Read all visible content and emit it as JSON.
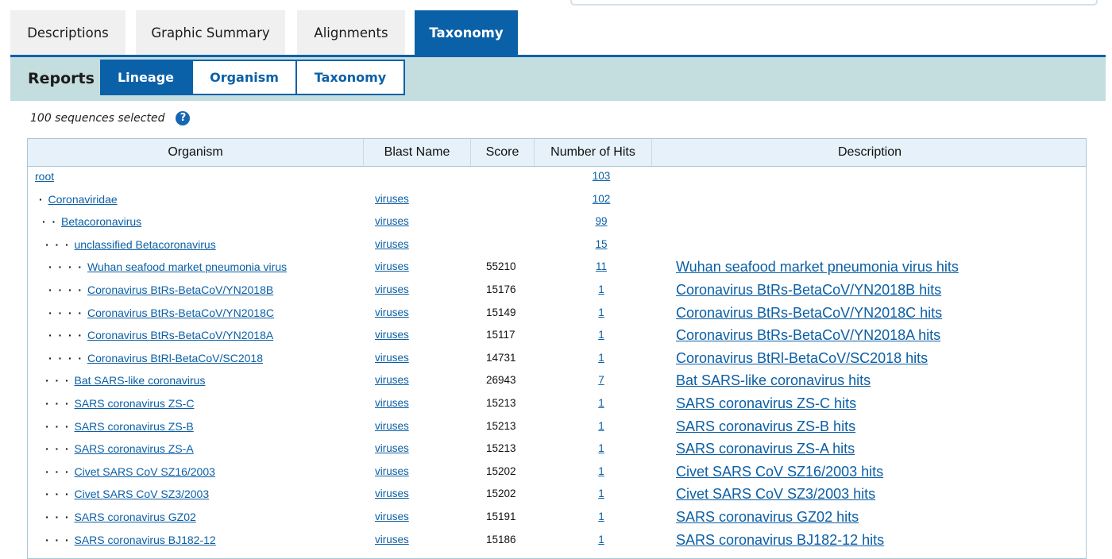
{
  "tabs": [
    {
      "label": "Descriptions",
      "active": false
    },
    {
      "label": "Graphic Summary",
      "active": false
    },
    {
      "label": "Alignments",
      "active": false
    },
    {
      "label": "Taxonomy",
      "active": true
    }
  ],
  "reports": {
    "label": "Reports",
    "tabs": [
      {
        "label": "Lineage",
        "active": true
      },
      {
        "label": "Organism",
        "active": false
      },
      {
        "label": "Taxonomy",
        "active": false
      }
    ]
  },
  "selection": {
    "text": "100 sequences selected",
    "help_icon": "question-circle-icon"
  },
  "table": {
    "headers": [
      "Organism",
      "Blast Name",
      "Score",
      "Number of Hits",
      "Description"
    ],
    "rows": [
      {
        "depth": 0,
        "organism": "root",
        "blast": "",
        "score": "",
        "hits": "103",
        "description": ""
      },
      {
        "depth": 1,
        "organism": "Coronaviridae",
        "blast": "viruses",
        "score": "",
        "hits": "102",
        "description": ""
      },
      {
        "depth": 2,
        "organism": "Betacoronavirus",
        "blast": "viruses",
        "score": "",
        "hits": "99",
        "description": ""
      },
      {
        "depth": 3,
        "organism": "unclassified Betacoronavirus",
        "blast": "viruses",
        "score": "",
        "hits": "15",
        "description": ""
      },
      {
        "depth": 4,
        "organism": "Wuhan seafood market pneumonia virus",
        "blast": "viruses",
        "score": "55210",
        "hits": "11",
        "description": "Wuhan seafood market pneumonia virus hits"
      },
      {
        "depth": 4,
        "organism": "Coronavirus BtRs-BetaCoV/YN2018B",
        "blast": "viruses",
        "score": "15176",
        "hits": "1",
        "description": "Coronavirus BtRs-BetaCoV/YN2018B hits"
      },
      {
        "depth": 4,
        "organism": "Coronavirus BtRs-BetaCoV/YN2018C",
        "blast": "viruses",
        "score": "15149",
        "hits": "1",
        "description": "Coronavirus BtRs-BetaCoV/YN2018C hits"
      },
      {
        "depth": 4,
        "organism": "Coronavirus BtRs-BetaCoV/YN2018A",
        "blast": "viruses",
        "score": "15117",
        "hits": "1",
        "description": "Coronavirus BtRs-BetaCoV/YN2018A hits"
      },
      {
        "depth": 4,
        "organism": "Coronavirus BtRl-BetaCoV/SC2018",
        "blast": "viruses",
        "score": "14731",
        "hits": "1",
        "description": "Coronavirus BtRl-BetaCoV/SC2018 hits"
      },
      {
        "depth": 3,
        "organism": "Bat SARS-like coronavirus",
        "blast": "viruses",
        "score": "26943",
        "hits": "7",
        "description": "Bat SARS-like coronavirus hits"
      },
      {
        "depth": 3,
        "organism": "SARS coronavirus ZS-C",
        "blast": "viruses",
        "score": "15213",
        "hits": "1",
        "description": "SARS coronavirus ZS-C hits"
      },
      {
        "depth": 3,
        "organism": "SARS coronavirus ZS-B",
        "blast": "viruses",
        "score": "15213",
        "hits": "1",
        "description": "SARS coronavirus ZS-B hits"
      },
      {
        "depth": 3,
        "organism": "SARS coronavirus ZS-A",
        "blast": "viruses",
        "score": "15213",
        "hits": "1",
        "description": "SARS coronavirus ZS-A hits"
      },
      {
        "depth": 3,
        "organism": "Civet SARS CoV SZ16/2003",
        "blast": "viruses",
        "score": "15202",
        "hits": "1",
        "description": "Civet SARS CoV SZ16/2003 hits"
      },
      {
        "depth": 3,
        "organism": "Civet SARS CoV SZ3/2003",
        "blast": "viruses",
        "score": "15202",
        "hits": "1",
        "description": "Civet SARS CoV SZ3/2003 hits"
      },
      {
        "depth": 3,
        "organism": "SARS coronavirus GZ02",
        "blast": "viruses",
        "score": "15191",
        "hits": "1",
        "description": "SARS coronavirus GZ02 hits"
      },
      {
        "depth": 3,
        "organism": "SARS coronavirus BJ182-12",
        "blast": "viruses",
        "score": "15186",
        "hits": "1",
        "description": "SARS coronavirus BJ182-12 hits"
      }
    ]
  }
}
